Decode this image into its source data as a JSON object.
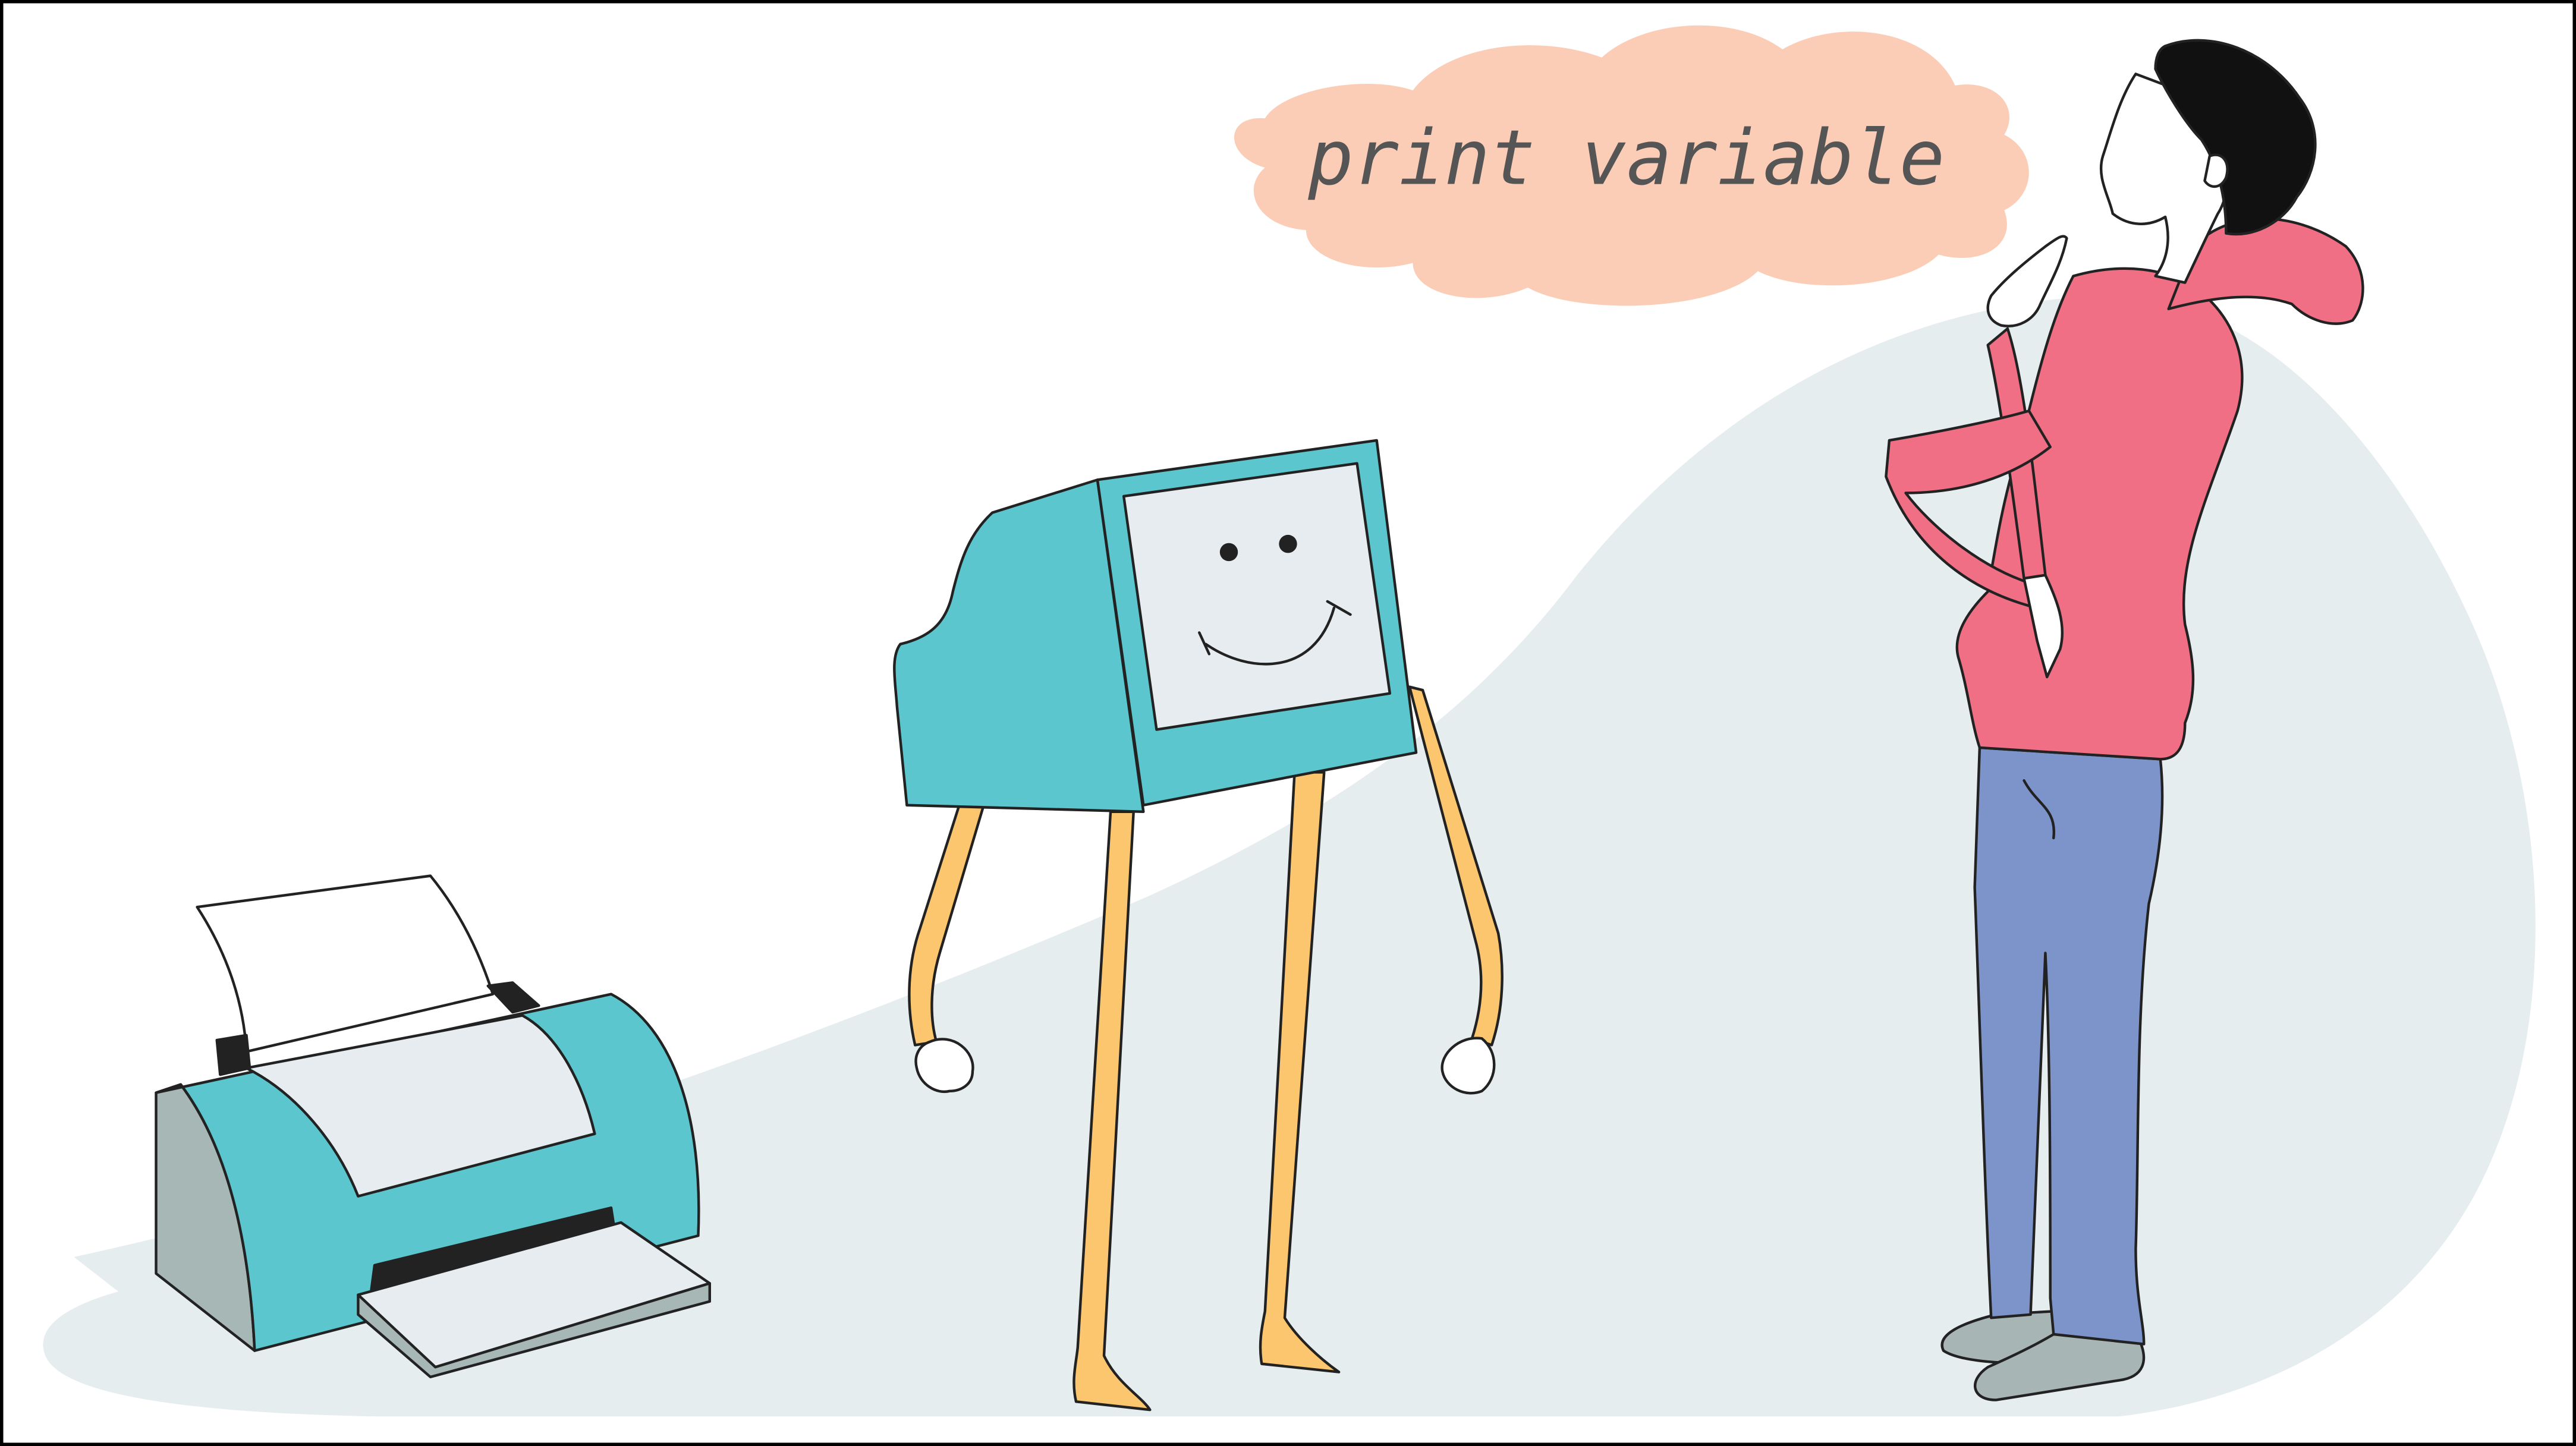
{
  "speech_bubble": {
    "text": "print variable"
  },
  "colors": {
    "background": "#ffffff",
    "ground": "#e6edef",
    "frame": "#000000",
    "bubble": "#fccdb6",
    "bubble_text": "#555555",
    "teal": "#5bc6cd",
    "screen": "#e6ecef",
    "limb": "#fcc66e",
    "paper": "#ffffff",
    "printer_side": "#a7b7b6",
    "shirt": "#f06f85",
    "jeans": "#7d94cb",
    "hair": "#111111",
    "shoe": "#a8b5b5",
    "outline": "#222222"
  },
  "icons": [
    "printer-icon",
    "computer-character-icon",
    "man-thinking-icon",
    "thought-cloud-icon"
  ]
}
